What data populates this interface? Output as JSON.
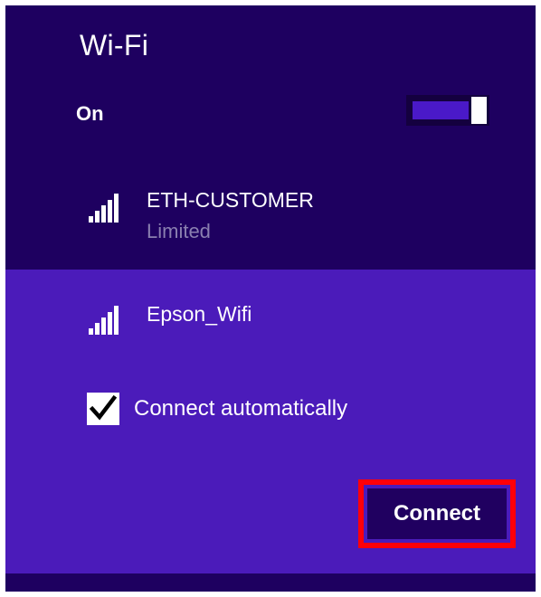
{
  "panel": {
    "title": "Wi-Fi",
    "wifi_toggle": {
      "label": "On",
      "state": "on"
    }
  },
  "networks": [
    {
      "name": "ETH-CUSTOMER",
      "status": "Limited",
      "icon": "wifi-signal-icon",
      "signal_level": 1.0
    },
    {
      "name": "Epson_Wifi",
      "icon": "wifi-signal-icon",
      "signal_level": 1.0,
      "selected": true,
      "connect_automatically": {
        "label": "Connect automatically",
        "checked": true
      },
      "connect_button": "Connect"
    }
  ],
  "colors": {
    "panel_bg": "#1e0060",
    "selected_bg": "#4b1bba",
    "toggle_accent": "#4a19c8",
    "highlight_frame": "#ff0008",
    "secondary_text": "#8a7fb0"
  }
}
